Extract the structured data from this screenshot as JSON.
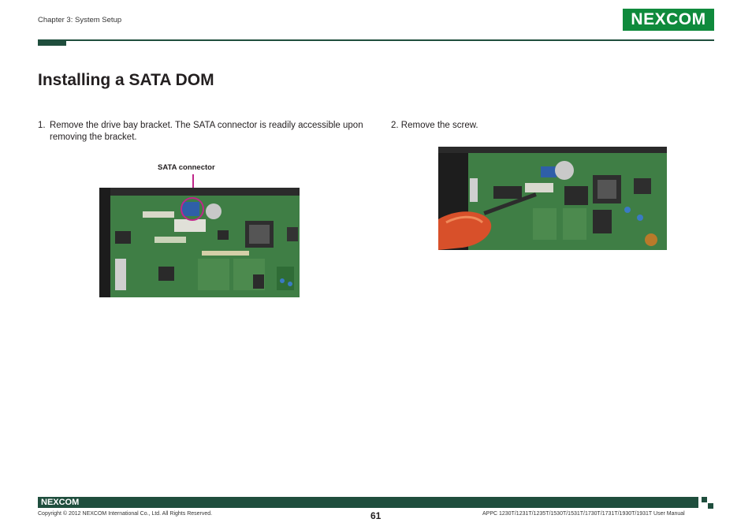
{
  "header": {
    "chapter": "Chapter 3: System Setup",
    "logo_text": "NEXCOM"
  },
  "page_title": "Installing a SATA DOM",
  "steps": [
    {
      "number": "1.",
      "text": "Remove the drive bay bracket. The SATA connector is readily accessible upon removing the bracket."
    },
    {
      "number": "2.",
      "text": "Remove the screw."
    }
  ],
  "figure1": {
    "callout_label": "SATA connector"
  },
  "footer": {
    "logo_text": "NEXCOM",
    "copyright": "Copyright © 2012 NEXCOM International Co., Ltd. All Rights Reserved.",
    "page_number": "61",
    "manual_title": "APPC 1230T/1231T/1235T/1530T/1531T/1730T/1731T/1930T/1931T User Manual"
  },
  "colors": {
    "brand_green": "#0f8a3c",
    "rule_green": "#1f4e3d",
    "callout_magenta": "#c0268a"
  }
}
